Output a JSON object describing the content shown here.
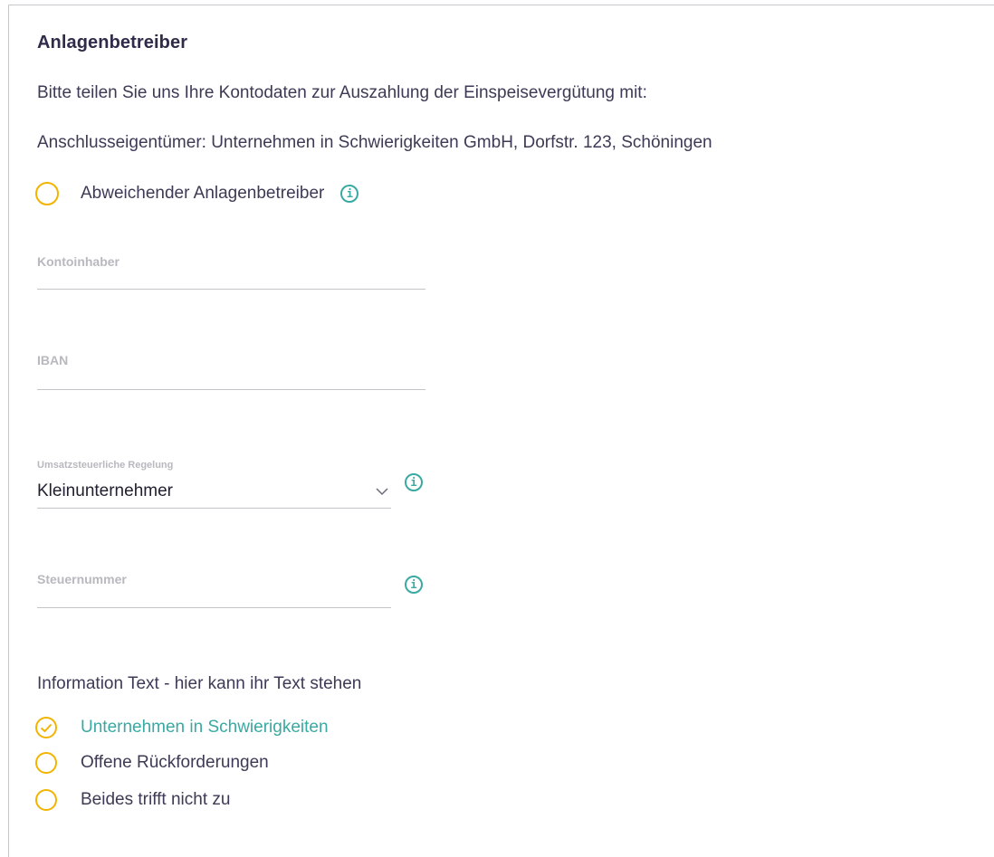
{
  "section": {
    "title": "Anlagenbetreiber",
    "intro": "Bitte teilen Sie uns Ihre Kontodaten zur Auszahlung der Einspeisevergütung mit:",
    "owner_line": "Anschlusseigentümer: Unternehmen in Schwierigkeiten GmbH, Dorfstr. 123, Schöningen"
  },
  "operator_option": {
    "label": "Abweichender Anlagenbetreiber",
    "checked": false,
    "info_icon": "info-icon"
  },
  "fields": {
    "account_holder": {
      "label": "Kontoinhaber",
      "value": ""
    },
    "iban": {
      "label": "IBAN",
      "value": ""
    },
    "tax_regulation": {
      "label": "Umsatzsteuerliche Regelung",
      "value": "Kleinunternehmer",
      "icon": "chevron-down-icon"
    },
    "tax_number": {
      "label": "Steuernummer",
      "value": ""
    }
  },
  "info_text": "Information Text - hier kann ihr Text stehen",
  "status_options": [
    {
      "label": "Unternehmen in Schwierigkeiten",
      "checked": true
    },
    {
      "label": "Offene Rückforderungen",
      "checked": false
    },
    {
      "label": "Beides trifft nicht zu",
      "checked": false
    }
  ],
  "colors": {
    "accent_radio": "#f2b400",
    "accent_info": "#3aa9a2",
    "text_primary": "#3d3a55"
  }
}
